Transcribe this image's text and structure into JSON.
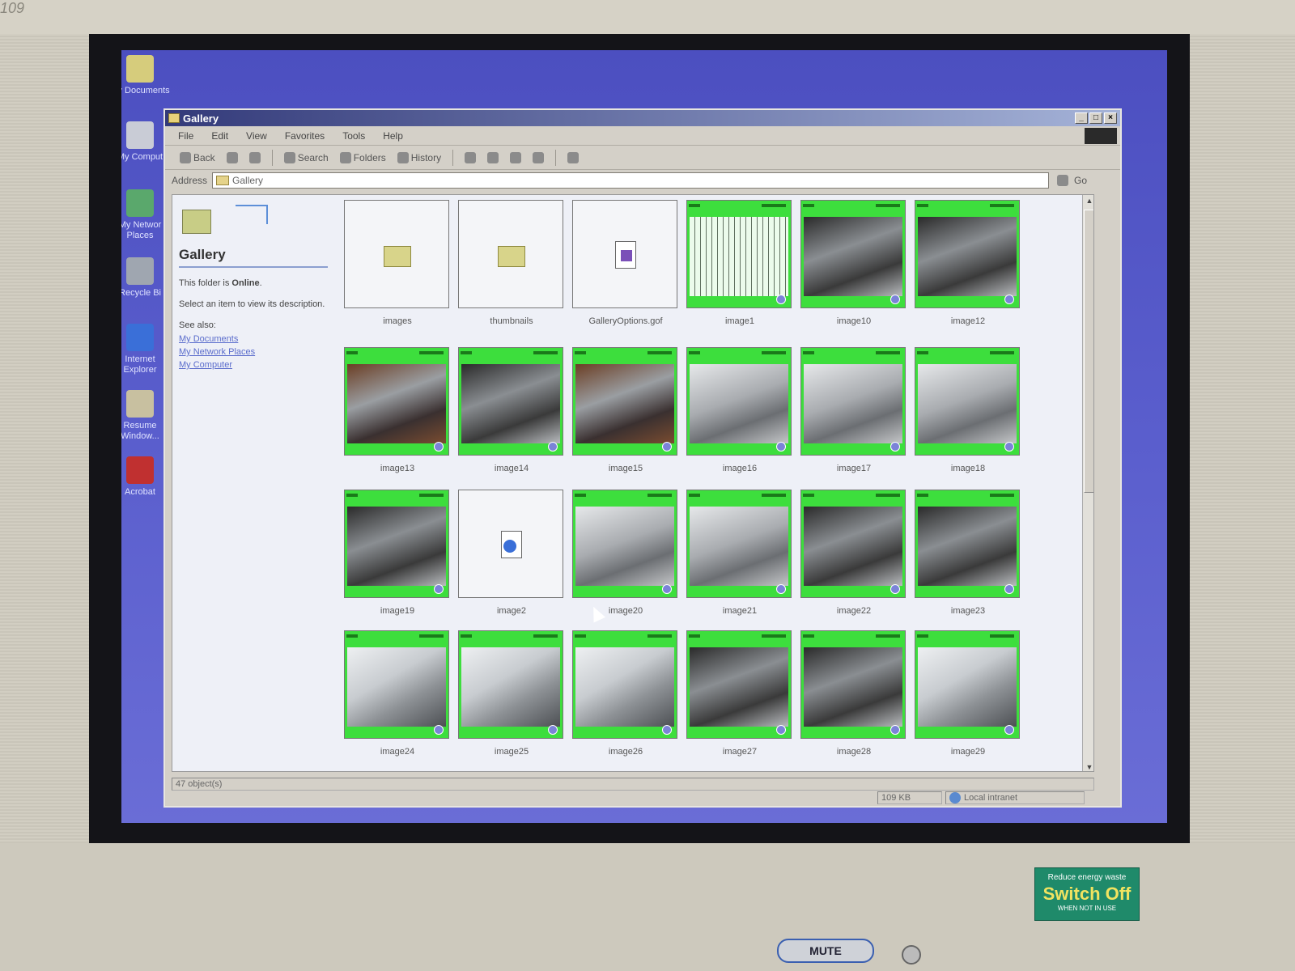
{
  "monitor": {
    "brand": "109",
    "sticker_line1": "Reduce energy waste",
    "sticker_line2": "Switch Off",
    "sticker_line3": "WHEN NOT IN USE",
    "mute_label": "MUTE"
  },
  "desktop_icons": [
    {
      "label": "My Documents",
      "icon": "folder-icon"
    },
    {
      "label": "My Comput",
      "icon": "computer-icon"
    },
    {
      "label": "My Networ Places",
      "icon": "network-icon"
    },
    {
      "label": "Recycle Bi",
      "icon": "recycle-bin-icon"
    },
    {
      "label": "Internet Explorer",
      "icon": "ie-icon"
    },
    {
      "label": "Resume Window...",
      "icon": "resume-icon"
    },
    {
      "label": "Acrobat",
      "icon": "acrobat-icon"
    }
  ],
  "window": {
    "title": "Gallery",
    "menu": [
      "File",
      "Edit",
      "View",
      "Favorites",
      "Tools",
      "Help"
    ],
    "toolbar": {
      "back": "Back",
      "search": "Search",
      "folders": "Folders",
      "history": "History"
    },
    "address": {
      "label": "Address",
      "value": "Gallery",
      "go": "Go"
    },
    "left_pane": {
      "title": "Gallery",
      "status_prefix": "This folder is ",
      "status_value": "Online",
      "description": "Select an item to view its description.",
      "see_also": "See also:",
      "links": [
        "My Documents",
        "My Network Places",
        "My Computer"
      ]
    },
    "items": [
      {
        "label": "images",
        "kind": "folder"
      },
      {
        "label": "thumbnails",
        "kind": "folder"
      },
      {
        "label": "GalleryOptions.gof",
        "kind": "file"
      },
      {
        "label": "image1",
        "kind": "photo",
        "style": "schem"
      },
      {
        "label": "image10",
        "kind": "photo",
        "style": "dark"
      },
      {
        "label": "image12",
        "kind": "photo",
        "style": "dark"
      },
      {
        "label": "image13",
        "kind": "photo",
        "style": "brown"
      },
      {
        "label": "image14",
        "kind": "photo",
        "style": "dark"
      },
      {
        "label": "image15",
        "kind": "photo",
        "style": "brown"
      },
      {
        "label": "image16",
        "kind": "photo",
        "style": "gray"
      },
      {
        "label": "image17",
        "kind": "photo",
        "style": "gray"
      },
      {
        "label": "image18",
        "kind": "photo",
        "style": "gray"
      },
      {
        "label": "image19",
        "kind": "photo",
        "style": "dark"
      },
      {
        "label": "image2",
        "kind": "htmlfile"
      },
      {
        "label": "image20",
        "kind": "photo",
        "style": "gray"
      },
      {
        "label": "image21",
        "kind": "photo",
        "style": "gray"
      },
      {
        "label": "image22",
        "kind": "photo",
        "style": "dark"
      },
      {
        "label": "image23",
        "kind": "photo",
        "style": "dark"
      },
      {
        "label": "image24",
        "kind": "photo",
        "style": "open"
      },
      {
        "label": "image25",
        "kind": "photo",
        "style": "open"
      },
      {
        "label": "image26",
        "kind": "photo",
        "style": "open"
      },
      {
        "label": "image27",
        "kind": "photo",
        "style": "dark"
      },
      {
        "label": "image28",
        "kind": "photo",
        "style": "dark"
      },
      {
        "label": "image29",
        "kind": "photo",
        "style": "open"
      }
    ],
    "status": {
      "objects": "47 object(s)",
      "size": "109 KB",
      "zone": "Local intranet"
    }
  }
}
